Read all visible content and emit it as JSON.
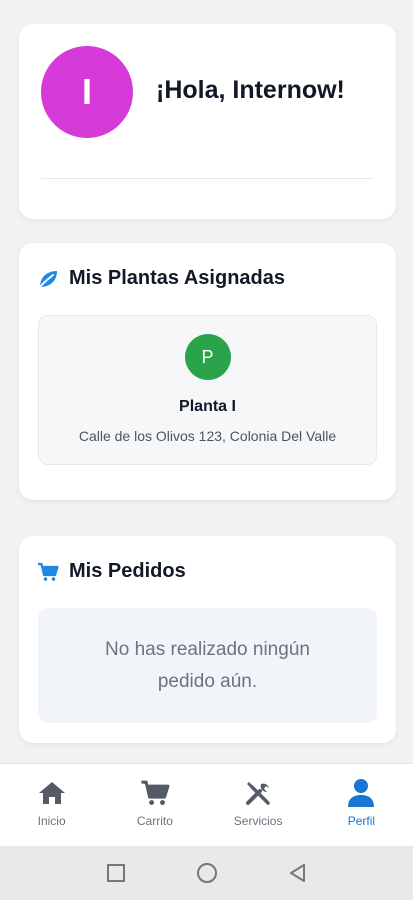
{
  "greeting": {
    "avatar_letter": "I",
    "text": "¡Hola, Internow!"
  },
  "plants": {
    "title": "Mis Plantas Asignadas",
    "icon": "leaf-icon",
    "items": [
      {
        "badge": "P",
        "name": "Planta I",
        "address": "Calle de los Olivos 123, Colonia Del Valle"
      }
    ]
  },
  "orders": {
    "title": "Mis Pedidos",
    "icon": "cart-icon",
    "empty_message": "No has realizado ningún pedido aún."
  },
  "bottom_nav": {
    "items": [
      {
        "label": "Inicio",
        "icon": "home-icon"
      },
      {
        "label": "Carrito",
        "icon": "cart-icon"
      },
      {
        "label": "Servicios",
        "icon": "tools-icon"
      },
      {
        "label": "Perfil",
        "icon": "user-icon",
        "active": true
      }
    ]
  },
  "colors": {
    "avatar": "#d63ad9",
    "plant_badge": "#2aa34a",
    "accent": "#1976d2"
  }
}
